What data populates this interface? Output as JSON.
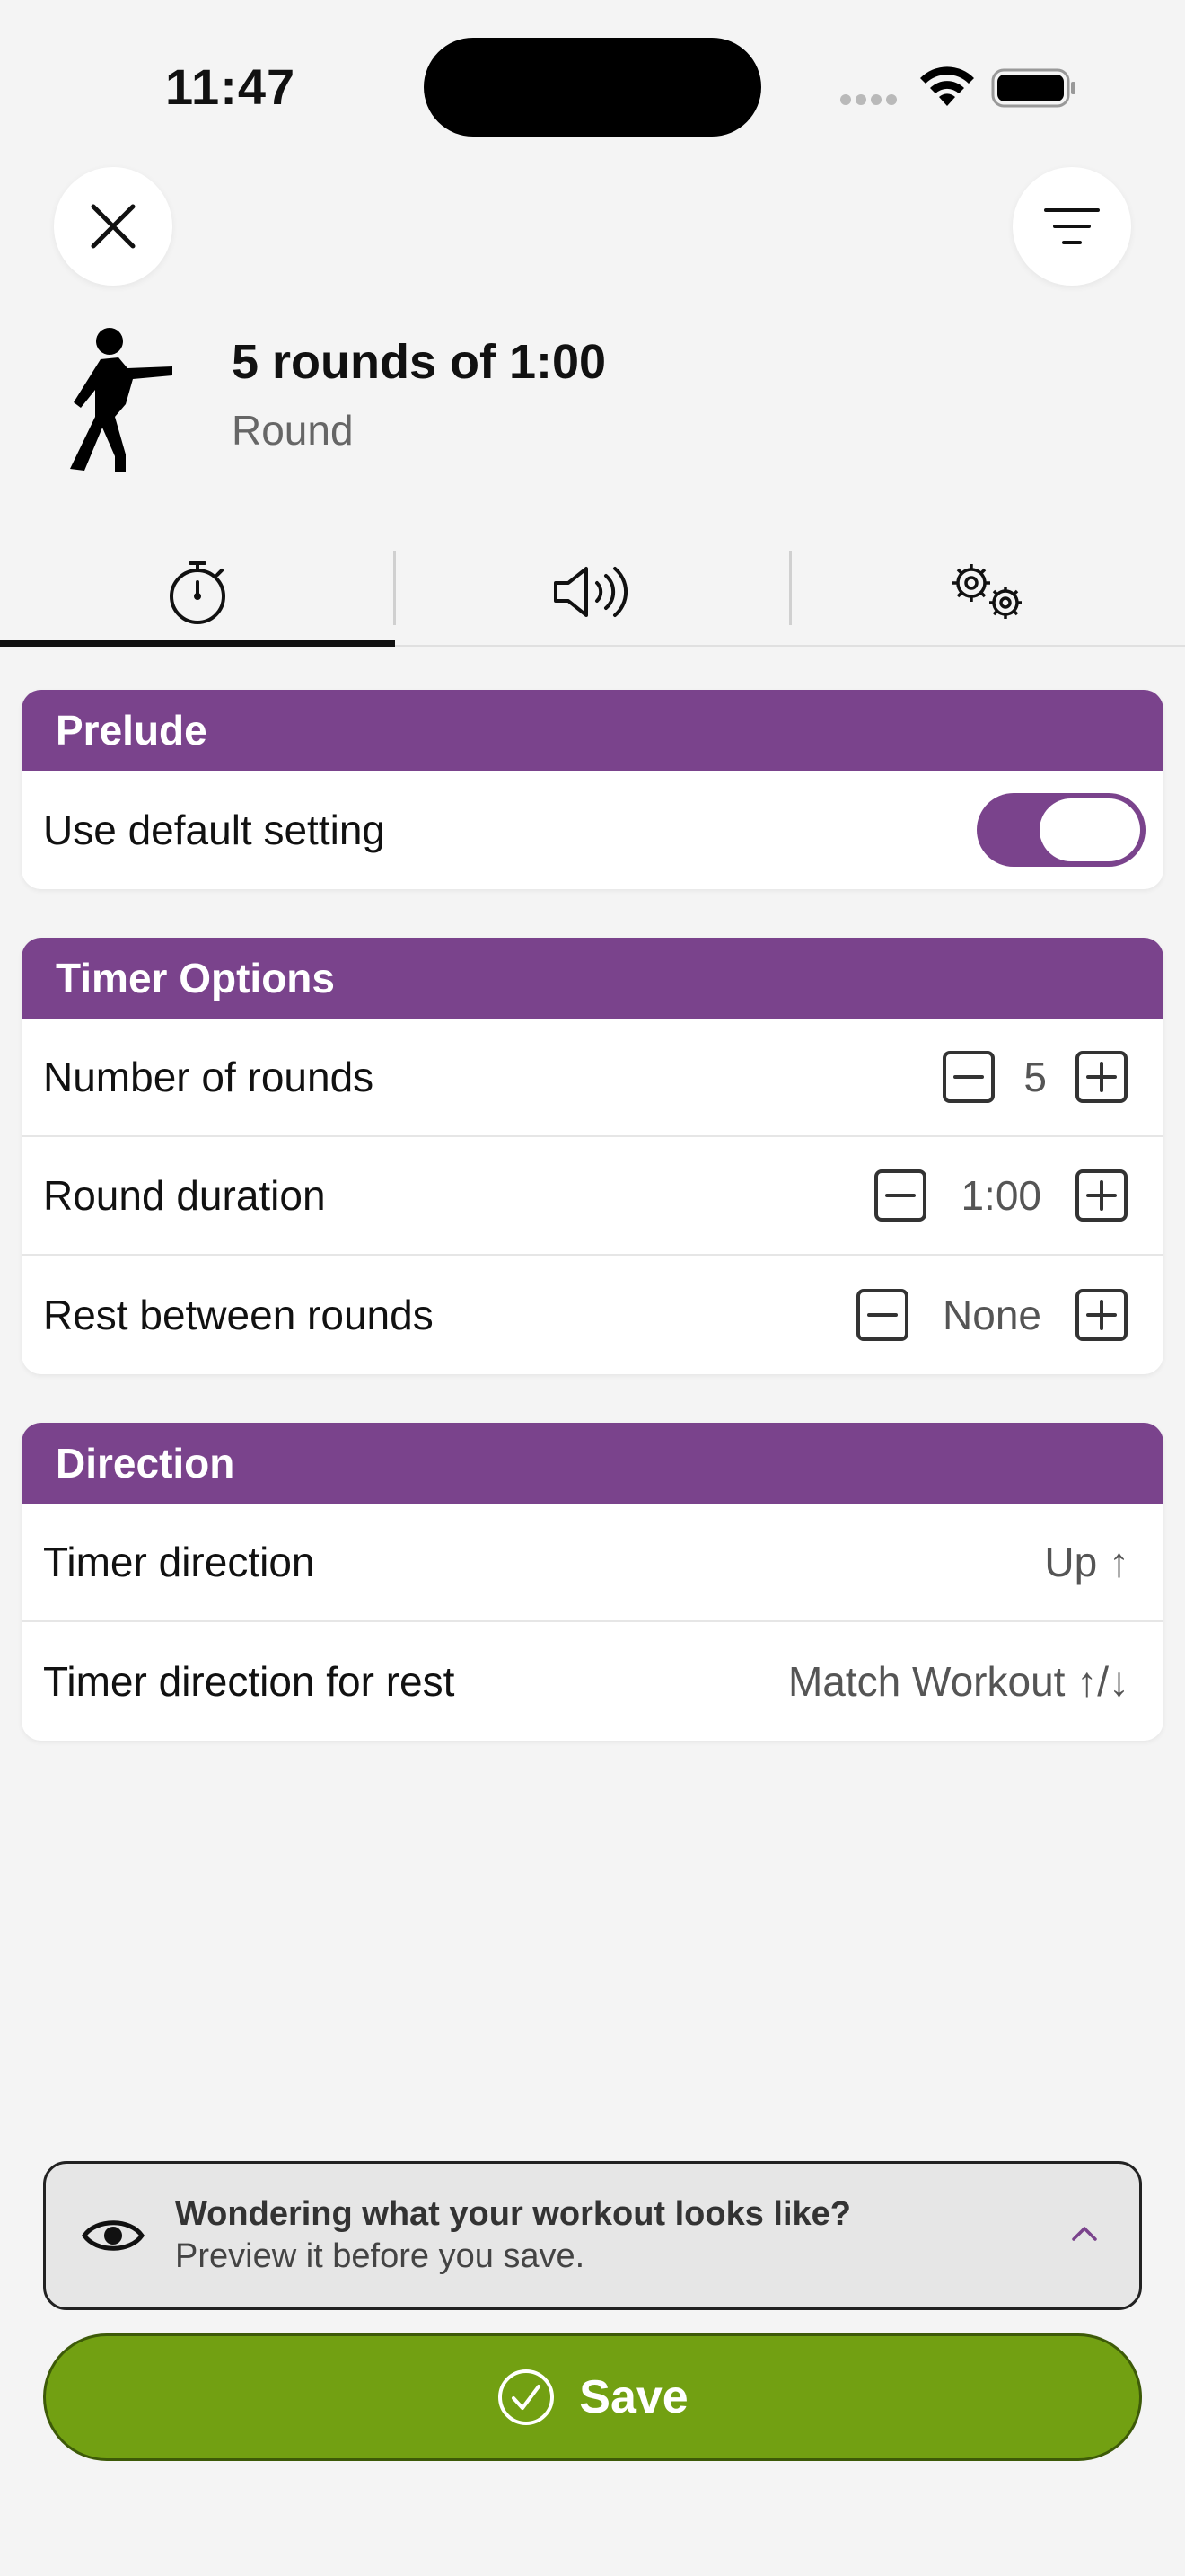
{
  "status_bar": {
    "time": "11:47"
  },
  "header": {
    "title": "5 rounds of 1:00",
    "subtitle": "Round",
    "icon": "figure-kickboxing-icon"
  },
  "tabs": [
    {
      "name": "timer",
      "icon": "stopwatch-icon",
      "active": true
    },
    {
      "name": "sounds",
      "icon": "speaker-icon",
      "active": false
    },
    {
      "name": "settings",
      "icon": "gears-icon",
      "active": false
    }
  ],
  "prelude": {
    "header": "Prelude",
    "default_label": "Use default setting",
    "default_on": true
  },
  "timer_options": {
    "header": "Timer Options",
    "rounds_label": "Number of rounds",
    "rounds_value": "5",
    "duration_label": "Round duration",
    "duration_value": "1:00",
    "rest_label": "Rest between rounds",
    "rest_value": "None"
  },
  "direction": {
    "header": "Direction",
    "timer_label": "Timer direction",
    "timer_value": "Up ↑",
    "rest_label": "Timer direction for rest",
    "rest_value": "Match Workout ↑/↓"
  },
  "preview": {
    "title": "Wondering what your workout looks like?",
    "subtitle": "Preview it before you save."
  },
  "save": {
    "label": "Save"
  },
  "colors": {
    "accent_purple": "#7a438c",
    "save_green": "#72a012",
    "background": "#f4f4f4"
  }
}
